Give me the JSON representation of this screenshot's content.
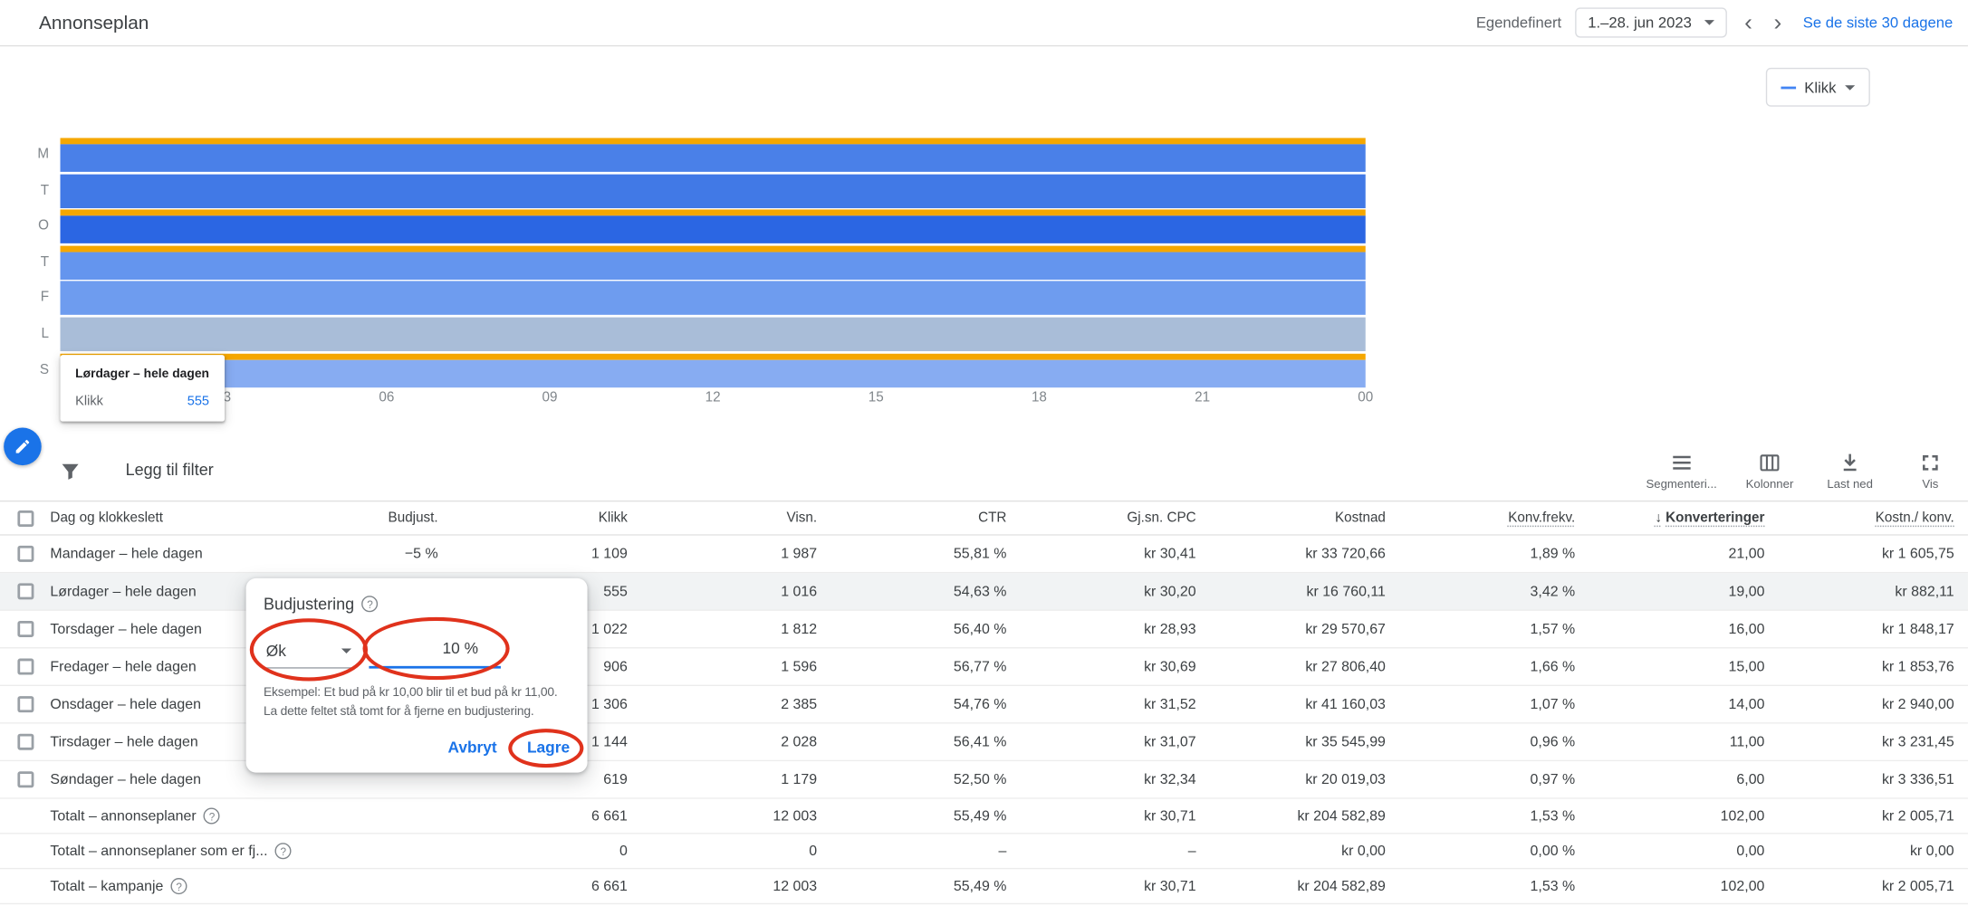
{
  "colors": {
    "primary_blue": "#1a73e8",
    "annotation_red": "#e0321c",
    "bar_accent_orange": "#f5a700"
  },
  "header": {
    "title": "Annonseplan",
    "custom_label": "Egendefinert",
    "date_value": "1.–28. jun 2023",
    "last30_link": "Se de siste 30 dagene"
  },
  "chart_data": {
    "type": "bar",
    "orientation": "horizontal",
    "metric": "Klikk",
    "x_ticks": [
      "03",
      "06",
      "09",
      "12",
      "15",
      "18",
      "21",
      "00"
    ],
    "x_range_hours": [
      0,
      24
    ],
    "accent_color": "#f5a700",
    "rows": [
      {
        "day_letter": "M",
        "day": "Mandager",
        "span": "hele dagen",
        "clicks": 1109,
        "color": "#4a80e8",
        "accent_top": true
      },
      {
        "day_letter": "T",
        "day": "Tirsdager",
        "span": "hele dagen",
        "clicks": 1144,
        "color": "#4179e6",
        "accent_top": false
      },
      {
        "day_letter": "O",
        "day": "Onsdager",
        "span": "hele dagen",
        "clicks": 1306,
        "color": "#2b66e3",
        "accent_top": true
      },
      {
        "day_letter": "T",
        "day": "Torsdager",
        "span": "hele dagen",
        "clicks": 1022,
        "color": "#6495ee",
        "accent_top": true
      },
      {
        "day_letter": "F",
        "day": "Fredager",
        "span": "hele dagen",
        "clicks": 906,
        "color": "#6e9cef",
        "accent_top": false
      },
      {
        "day_letter": "L",
        "day": "Lørdager",
        "span": "hele dagen",
        "clicks": 555,
        "color": "#a9bdd8",
        "accent_top": false,
        "state": "hovered"
      },
      {
        "day_letter": "S",
        "day": "Søndager",
        "span": "hele dagen",
        "clicks": 619,
        "color": "#87acf2",
        "accent_top": true
      }
    ]
  },
  "chart_tooltip": {
    "title": "Lørdager – hele dagen",
    "metric": "Klikk",
    "value": "555"
  },
  "toolbar": {
    "filter_label": "Legg til filter",
    "tools": [
      {
        "id": "segment",
        "label": "Segmenteri..."
      },
      {
        "id": "columns",
        "label": "Kolonner"
      },
      {
        "id": "download",
        "label": "Last ned"
      },
      {
        "id": "expand",
        "label": "Vis"
      }
    ]
  },
  "table": {
    "sorted_by": "Konverteringer",
    "sort_direction": "desc",
    "columns": [
      {
        "label": "Dag og klokkeslett"
      },
      {
        "label": "Budjust."
      },
      {
        "label": "Klikk"
      },
      {
        "label": "Visn."
      },
      {
        "label": "CTR"
      },
      {
        "label": "Gj.sn. CPC"
      },
      {
        "label": "Kostnad"
      },
      {
        "label": "Konv.frekv.",
        "dotted": true
      },
      {
        "label": "Konverteringer",
        "dotted": true,
        "sorted": true
      },
      {
        "label": "Kostn./ konv.",
        "dotted": true
      }
    ],
    "rows": [
      {
        "type": "day",
        "label": "Mandager – hele dagen",
        "selected": false,
        "values": [
          "−5 %",
          "1 109",
          "1 987",
          "55,81 %",
          "kr 30,41",
          "kr 33 720,66",
          "1,89 %",
          "21,00",
          "kr 1 605,75"
        ]
      },
      {
        "type": "day",
        "label": "Lørdager – hele dagen",
        "selected": true,
        "values": [
          "",
          "555",
          "1 016",
          "54,63 %",
          "kr 30,20",
          "kr 16 760,11",
          "3,42 %",
          "19,00",
          "kr 882,11"
        ]
      },
      {
        "type": "day",
        "label": "Torsdager – hele dagen",
        "selected": false,
        "values": [
          "",
          "1 022",
          "1 812",
          "56,40 %",
          "kr 28,93",
          "kr 29 570,67",
          "1,57 %",
          "16,00",
          "kr 1 848,17"
        ]
      },
      {
        "type": "day",
        "label": "Fredager – hele dagen",
        "selected": false,
        "values": [
          "",
          "906",
          "1 596",
          "56,77 %",
          "kr 30,69",
          "kr 27 806,40",
          "1,66 %",
          "15,00",
          "kr 1 853,76"
        ]
      },
      {
        "type": "day",
        "label": "Onsdager – hele dagen",
        "selected": false,
        "values": [
          "",
          "1 306",
          "2 385",
          "54,76 %",
          "kr 31,52",
          "kr 41 160,03",
          "1,07 %",
          "14,00",
          "kr 2 940,00"
        ]
      },
      {
        "type": "day",
        "label": "Tirsdager – hele dagen",
        "selected": false,
        "values": [
          "",
          "1 144",
          "2 028",
          "56,41 %",
          "kr 31,07",
          "kr 35 545,99",
          "0,96 %",
          "11,00",
          "kr 3 231,45"
        ]
      },
      {
        "type": "day",
        "label": "Søndager – hele dagen",
        "selected": false,
        "values": [
          "",
          "619",
          "1 179",
          "52,50 %",
          "kr 32,34",
          "kr 20 019,03",
          "0,97 %",
          "6,00",
          "kr 3 336,51"
        ]
      },
      {
        "type": "total",
        "label": "Totalt – annonseplaner",
        "help": true,
        "values": [
          "",
          "6 661",
          "12 003",
          "55,49 %",
          "kr 30,71",
          "kr 204 582,89",
          "1,53 %",
          "102,00",
          "kr 2 005,71"
        ]
      },
      {
        "type": "total",
        "label": "Totalt – annonseplaner som er fj...",
        "help": true,
        "values": [
          "",
          "0",
          "0",
          "–",
          "–",
          "kr 0,00",
          "0,00 %",
          "0,00",
          "kr 0,00"
        ]
      },
      {
        "type": "total",
        "label": "Totalt – kampanje",
        "help": true,
        "values": [
          "",
          "6 661",
          "12 003",
          "55,49 %",
          "kr 30,71",
          "kr 204 582,89",
          "1,53 %",
          "102,00",
          "kr 2 005,71"
        ]
      }
    ]
  },
  "dialog": {
    "title": "Budjustering",
    "dropdown_value": "Øk",
    "input_value": "10 %",
    "example_line1": "Eksempel: Et bud på kr 10,00 blir til et bud på kr 11,00.",
    "example_line2": "La dette feltet stå tomt for å fjerne en budjustering.",
    "cancel": "Avbryt",
    "save": "Lagre"
  }
}
